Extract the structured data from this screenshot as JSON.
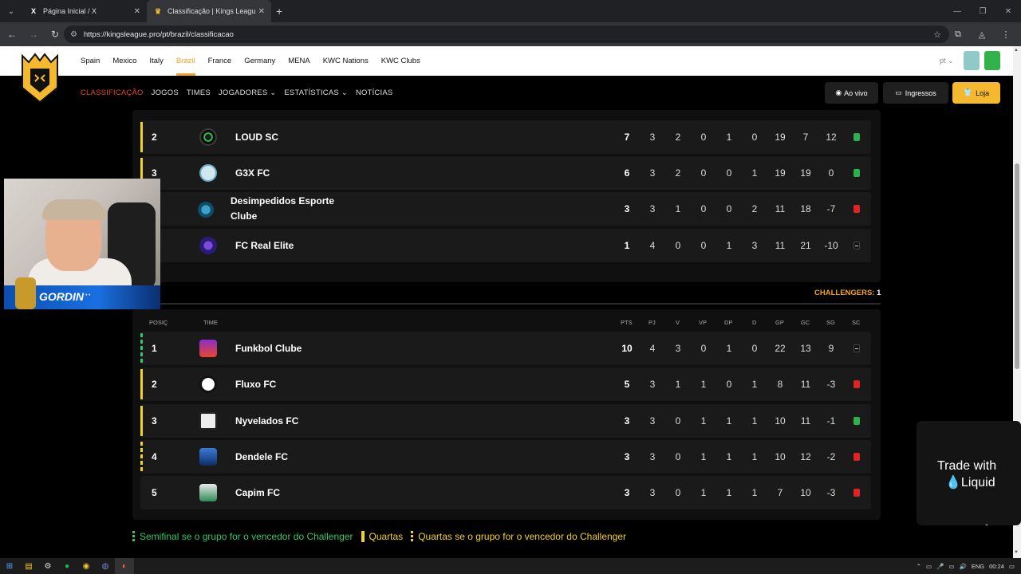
{
  "browser": {
    "tabs": [
      {
        "title": "Página Inicial / X",
        "icon": "x-logo-icon"
      },
      {
        "title": "Classificação | Kings League Bra",
        "icon": "kings-league-crown-icon"
      }
    ],
    "url": "https://kingsleague.pro/pt/brazil/classificacao"
  },
  "site": {
    "countries": [
      "Spain",
      "Mexico",
      "Italy",
      "Brazil",
      "France",
      "Germany",
      "MENA",
      "KWC Nations",
      "KWC Clubs"
    ],
    "active_country": "Brazil",
    "lang": "pt",
    "nav": [
      "CLASSIFICAÇÃO",
      "JOGOS",
      "TIMES",
      "JOGADORES",
      "ESTATÍSTICAS",
      "NOTÍCIAS"
    ],
    "buttons": {
      "live": "Ao vivo",
      "tickets": "Ingressos",
      "shop": "Loja"
    }
  },
  "group_a": {
    "rows": [
      {
        "pos": "2",
        "team": "LOUD SC",
        "pts": "7",
        "pj": "3",
        "v": "2",
        "vp": "0",
        "dp": "1",
        "d": "0",
        "gp": "19",
        "gc": "7",
        "sg": "12",
        "sc": "green"
      },
      {
        "pos": "3",
        "team": "G3X FC",
        "pts": "6",
        "pj": "3",
        "v": "2",
        "vp": "0",
        "dp": "0",
        "d": "1",
        "gp": "19",
        "gc": "19",
        "sg": "0",
        "sc": "green"
      },
      {
        "pos": "",
        "team": "Desimpedidos Esporte Clube",
        "pts": "3",
        "pj": "3",
        "v": "1",
        "vp": "0",
        "dp": "0",
        "d": "2",
        "gp": "11",
        "gc": "18",
        "sg": "-7",
        "sc": "red"
      },
      {
        "pos": "",
        "team": "FC Real Elite",
        "pts": "1",
        "pj": "4",
        "v": "0",
        "vp": "0",
        "dp": "1",
        "d": "3",
        "gp": "11",
        "gc": "21",
        "sg": "-10",
        "sc": "dash"
      }
    ]
  },
  "challengers": {
    "label": "CHALLENGERS:",
    "value": "1"
  },
  "group_b": {
    "headers": [
      "POSIÇ",
      "TIME",
      "PTS",
      "PJ",
      "V",
      "VP",
      "DP",
      "D",
      "GP",
      "GC",
      "SG",
      "SC"
    ],
    "rows": [
      {
        "pos": "1",
        "team": "Funkbol Clube",
        "pts": "10",
        "pj": "4",
        "v": "3",
        "vp": "0",
        "dp": "1",
        "d": "0",
        "gp": "22",
        "gc": "13",
        "sg": "9",
        "sc": "dash"
      },
      {
        "pos": "2",
        "team": "Fluxo FC",
        "pts": "5",
        "pj": "3",
        "v": "1",
        "vp": "1",
        "dp": "0",
        "d": "1",
        "gp": "8",
        "gc": "11",
        "sg": "-3",
        "sc": "red"
      },
      {
        "pos": "3",
        "team": "Nyvelados FC",
        "pts": "3",
        "pj": "3",
        "v": "0",
        "vp": "1",
        "dp": "1",
        "d": "1",
        "gp": "10",
        "gc": "11",
        "sg": "-1",
        "sc": "green"
      },
      {
        "pos": "4",
        "team": "Dendele FC",
        "pts": "3",
        "pj": "3",
        "v": "0",
        "vp": "1",
        "dp": "1",
        "d": "1",
        "gp": "10",
        "gc": "12",
        "sg": "-2",
        "sc": "red"
      },
      {
        "pos": "5",
        "team": "Capim FC",
        "pts": "3",
        "pj": "3",
        "v": "0",
        "vp": "1",
        "dp": "1",
        "d": "1",
        "gp": "7",
        "gc": "10",
        "sg": "-3",
        "sc": "red"
      }
    ]
  },
  "legend": [
    {
      "text": "Semifinal se o grupo for o vencedor do Challenger",
      "color": "#32c76a"
    },
    {
      "text": "Quartas",
      "color": "#f2d21e"
    },
    {
      "text": "Quartas se o grupo for o vencedor do Challenger",
      "color": "#f2d21e"
    }
  ],
  "webcam": {
    "name": "GORDIN"
  },
  "ad": {
    "line1": "Trade with",
    "line2": "Liquid"
  },
  "taskbar": {
    "lang": "ENG",
    "time": "00:24"
  }
}
